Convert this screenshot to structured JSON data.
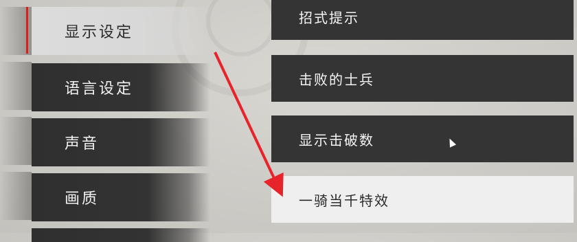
{
  "sidebar": {
    "items": [
      {
        "label": "显示设定",
        "active": true
      },
      {
        "label": "语言设定",
        "active": false
      },
      {
        "label": "声音",
        "active": false
      },
      {
        "label": "画质",
        "active": false
      }
    ]
  },
  "options": [
    {
      "label": "招式提示",
      "selected": false
    },
    {
      "label": "击败的士兵",
      "selected": false
    },
    {
      "label": "显示击破数",
      "selected": false
    },
    {
      "label": "一骑当千特效",
      "selected": true
    }
  ],
  "colors": {
    "accent": "#c22a2a",
    "panel_dark": "#343434",
    "panel_light": "#efefef",
    "annotation_arrow": "#e8242b"
  }
}
